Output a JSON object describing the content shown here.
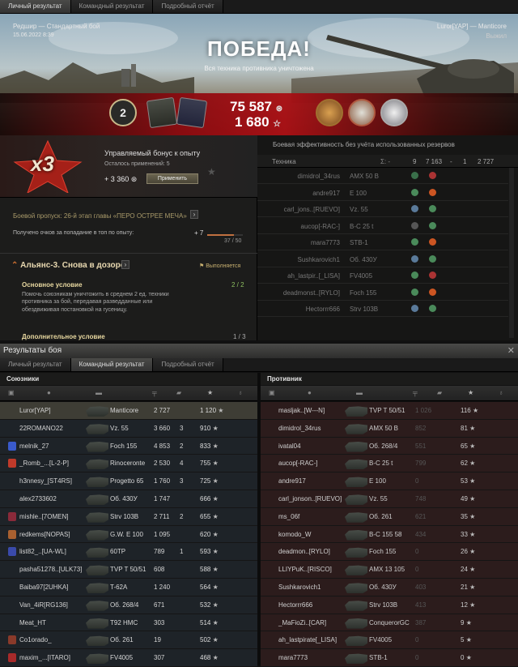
{
  "tabs_top": [
    "Личный результат",
    "Командный результат",
    "Подробный отчёт"
  ],
  "hero": {
    "map_mode": "Редшир — Стандартный бой",
    "datetime": "15.06.2022 8:39",
    "player": "Luror[YAP] — Manticore",
    "status": "Выжил",
    "victory": "ПОБЕДА!",
    "victory_sub": "Вся техника противника уничтожена",
    "medal_number": "2",
    "xp": "75 587",
    "credits": "1 680"
  },
  "bonus": {
    "multiplier": "x3",
    "title": "Управляемый бонус к опыту",
    "remaining": "Осталось применений: 5",
    "value": "+ 3 360",
    "apply": "Применить"
  },
  "battlepass": {
    "text": "Боевой пропуск: 26-й этап главы «ПЕРО ОСТРЕЕ МЕЧА»",
    "points_label": "Получено очков за попадание в топ по опыту:",
    "points": "+ 7",
    "progress": "37 / 50",
    "progress_value": 0.74
  },
  "mission": {
    "title": "Альянс-3. Снова в дозоре",
    "status": "Выполняется",
    "main_label": "Основное условие",
    "main_count": "2 / 2",
    "main_desc": "Помочь союзникам уничтожить в среднем 2 ед. техники противника за бой, передавая разведданные или обездвиживая постановкой на гусеницу.",
    "extra_label": "Дополнительное условие",
    "extra_count": "1 / 3"
  },
  "efficiency": {
    "header": "Боевая эффективность без учёта использованных резервов",
    "col_tech": "Техника",
    "cols": [
      "Σ: -",
      "9",
      "7 163",
      "-",
      "1",
      "2 727"
    ],
    "rows": [
      {
        "name": "dimidrol_34rus",
        "tank": "AMX 50 B"
      },
      {
        "name": "andre917",
        "tank": "E 100"
      },
      {
        "name": "carl_jons..[RUEVO]",
        "tank": "Vz. 55"
      },
      {
        "name": "aucop[-RAC-]",
        "tank": "B-C 25 t"
      },
      {
        "name": "mara7773",
        "tank": "STB-1"
      },
      {
        "name": "Sushkarovich1",
        "tank": "Об. 430У"
      },
      {
        "name": "ah_lastpir..[_LISA]",
        "tank": "FV4005"
      },
      {
        "name": "deadmonst..[RYLO]",
        "tank": "Foch 155"
      },
      {
        "name": "Hectorrr666",
        "tank": "Strv 103B"
      }
    ]
  },
  "results_title": "Результаты боя",
  "tabs_bottom": [
    "Личный результат",
    "Командный результат",
    "Подробный отчёт"
  ],
  "allies_label": "Союзники",
  "enemies_label": "Противник",
  "allies": [
    {
      "name": "Luror[YAP]",
      "tank": "Manticore",
      "dmg": "2 727",
      "kills": "",
      "xp": "1 120"
    },
    {
      "name": "22ROMANO22",
      "tank": "Vz. 55",
      "dmg": "3 660",
      "kills": "3",
      "xp": "910"
    },
    {
      "name": "melnik_27",
      "tank": "Foch 155",
      "dmg": "4 853",
      "kills": "2",
      "xp": "833"
    },
    {
      "name": "_Romb_...[L-2-P]",
      "tank": "Rinoceronte",
      "dmg": "2 530",
      "kills": "4",
      "xp": "755"
    },
    {
      "name": "h3nnesy_[ST4RS]",
      "tank": "Progetto 65",
      "dmg": "1 760",
      "kills": "3",
      "xp": "725"
    },
    {
      "name": "alex2733602",
      "tank": "Об. 430У",
      "dmg": "1 747",
      "kills": "",
      "xp": "666"
    },
    {
      "name": "mishle..[7OMEN]",
      "tank": "Strv 103B",
      "dmg": "2 711",
      "kills": "2",
      "xp": "655"
    },
    {
      "name": "redkems[NOPAS]",
      "tank": "G.W. E 100",
      "dmg": "1 095",
      "kills": "",
      "xp": "620"
    },
    {
      "name": "list82_..[UA-WL]",
      "tank": "60TP",
      "dmg": "789",
      "kills": "1",
      "xp": "593"
    },
    {
      "name": "pasha51278..[ULK73]",
      "tank": "TVP T 50/51",
      "dmg": "608",
      "kills": "",
      "xp": "588"
    },
    {
      "name": "Baiba97[2UHKA]",
      "tank": "T-62A",
      "dmg": "1 240",
      "kills": "",
      "xp": "564"
    },
    {
      "name": "Van_4iR[RG136]",
      "tank": "Об. 268/4",
      "dmg": "671",
      "kills": "",
      "xp": "532"
    },
    {
      "name": "Meat_HT",
      "tank": "T92 HMC",
      "dmg": "303",
      "kills": "",
      "xp": "514"
    },
    {
      "name": "Co1orado_",
      "tank": "Об. 261",
      "dmg": "19",
      "kills": "",
      "xp": "502"
    },
    {
      "name": "maxim_...[ITARO]",
      "tank": "FV4005",
      "dmg": "307",
      "kills": "",
      "xp": "468"
    }
  ],
  "enemies": [
    {
      "name": "masljak..[W---N]",
      "tank": "TVP T 50/51",
      "dmg": "1 026",
      "xp": "116"
    },
    {
      "name": "dimidrol_34rus",
      "tank": "AMX 50 B",
      "dmg": "852",
      "xp": "81"
    },
    {
      "name": "ivatal04",
      "tank": "Об. 268/4",
      "dmg": "551",
      "xp": "65"
    },
    {
      "name": "aucop[-RAC-]",
      "tank": "B-C 25 t",
      "dmg": "799",
      "xp": "62"
    },
    {
      "name": "andre917",
      "tank": "E 100",
      "dmg": "0",
      "xp": "53"
    },
    {
      "name": "carl_jonson..[RUEVO]",
      "tank": "Vz. 55",
      "dmg": "748",
      "xp": "49"
    },
    {
      "name": "ms_06f",
      "tank": "Об. 261",
      "dmg": "621",
      "xp": "35"
    },
    {
      "name": "komodo_W",
      "tank": "B-C 155 58",
      "dmg": "434",
      "xp": "33"
    },
    {
      "name": "deadmon..[RYLO]",
      "tank": "Foch 155",
      "dmg": "0",
      "xp": "26"
    },
    {
      "name": "LLIYPuK..[RISCO]",
      "tank": "AMX 13 105",
      "dmg": "0",
      "xp": "24"
    },
    {
      "name": "Sushkarovich1",
      "tank": "Об. 430У",
      "dmg": "403",
      "xp": "21"
    },
    {
      "name": "Hectorrr666",
      "tank": "Strv 103B",
      "dmg": "413",
      "xp": "12"
    },
    {
      "name": "_MaFioZi..[CAR]",
      "tank": "ConquerorGC",
      "dmg": "387",
      "xp": "9"
    },
    {
      "name": "ah_lastpirate[_LISA]",
      "tank": "FV4005",
      "dmg": "0",
      "xp": "5"
    },
    {
      "name": "mara7773",
      "tank": "STB-1",
      "dmg": "0",
      "xp": "0"
    }
  ]
}
